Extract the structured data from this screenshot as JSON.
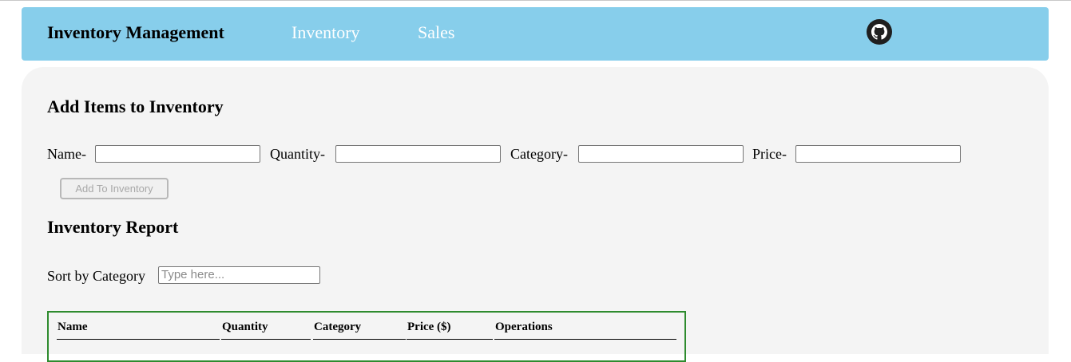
{
  "navbar": {
    "brand": "Inventory Management",
    "links": [
      "Inventory",
      "Sales"
    ],
    "github_icon": "github-icon",
    "bg_color": "#87ceeb"
  },
  "add_section": {
    "title": "Add Items to Inventory",
    "fields": [
      {
        "label": "Name-",
        "value": ""
      },
      {
        "label": "Quantity-",
        "value": ""
      },
      {
        "label": "Category-",
        "value": ""
      },
      {
        "label": "Price-",
        "value": ""
      }
    ],
    "button_label": "Add To Inventory"
  },
  "report_section": {
    "title": "Inventory Report",
    "sort_label": "Sort by Category",
    "sort_placeholder": "Type here...",
    "table_headers": [
      "Name",
      "Quantity",
      "Category",
      "Price ($)",
      "Operations"
    ],
    "border_color": "#2e8b2e"
  }
}
